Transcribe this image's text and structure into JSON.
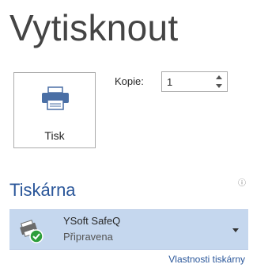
{
  "page": {
    "title": "Vytisknout"
  },
  "print_button": {
    "label": "Tisk",
    "icon": "printer-icon"
  },
  "copies": {
    "label": "Kopie:",
    "value": "1"
  },
  "printer": {
    "section_title": "Tiskárna",
    "info_icon": "info-icon",
    "name": "YSoft SafeQ",
    "status": "Připravena",
    "icon": "printer-ready-icon",
    "properties_link": "Vlastnosti tiskárny"
  },
  "colors": {
    "accent": "#2b579a",
    "selection": "#c5d7ee",
    "ready_green": "#2e9e3a"
  }
}
